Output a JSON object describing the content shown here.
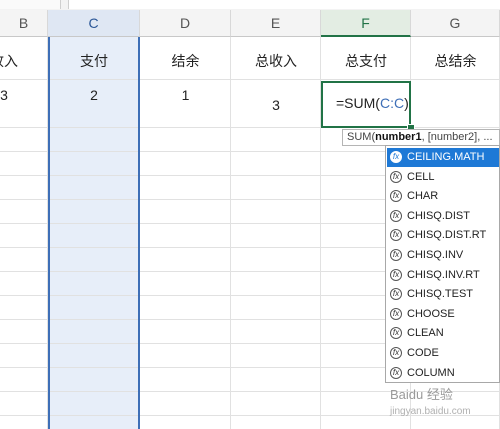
{
  "columns": [
    {
      "id": "B",
      "label": "B"
    },
    {
      "id": "C",
      "label": "C"
    },
    {
      "id": "D",
      "label": "D"
    },
    {
      "id": "E",
      "label": "E"
    },
    {
      "id": "F",
      "label": "F"
    },
    {
      "id": "G",
      "label": "G"
    }
  ],
  "row1": {
    "B": "收入",
    "C": "支付",
    "D": "结余",
    "E": "总收入",
    "F": "总支付",
    "G": "总结余"
  },
  "row2": {
    "B": "3",
    "C": "2",
    "D": "1",
    "E": "3"
  },
  "active_cell": {
    "prefix": "=SUM(",
    "ref": "C:C",
    "suffix": ")"
  },
  "tooltip": {
    "prefix": "SUM(",
    "bold": "number1",
    "rest": ", [number2], ..."
  },
  "autocomplete": {
    "selected_index": 0,
    "icon_glyph": "fx",
    "items": [
      "CEILING.MATH",
      "CELL",
      "CHAR",
      "CHISQ.DIST",
      "CHISQ.DIST.RT",
      "CHISQ.INV",
      "CHISQ.INV.RT",
      "CHISQ.TEST",
      "CHOOSE",
      "CLEAN",
      "CODE",
      "COLUMN"
    ]
  },
  "watermark": {
    "text": "Baidu 经验",
    "sub": "jingyan.baidu.com"
  },
  "colors": {
    "accent": "#217346",
    "selection": "#3e6fb7",
    "dropdown_highlight": "#1e79d6"
  }
}
